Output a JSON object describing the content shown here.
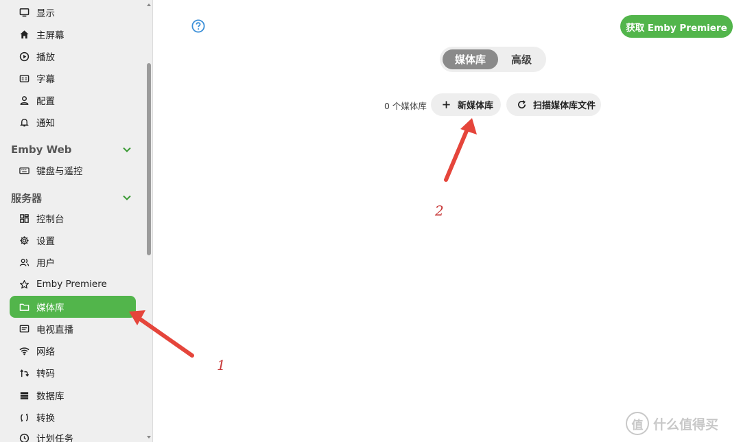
{
  "sidebar": {
    "items_top": [
      {
        "label": "显示",
        "icon": "monitor-icon"
      },
      {
        "label": "主屏幕",
        "icon": "home-icon"
      },
      {
        "label": "播放",
        "icon": "play-circle-icon"
      },
      {
        "label": "字幕",
        "icon": "subtitles-icon"
      },
      {
        "label": "配置",
        "icon": "profile-icon"
      },
      {
        "label": "通知",
        "icon": "bell-icon"
      }
    ],
    "section_web": {
      "title": "Emby Web"
    },
    "items_web": [
      {
        "label": "键盘与遥控",
        "icon": "keyboard-icon"
      }
    ],
    "section_server": {
      "title": "服务器"
    },
    "items_server": [
      {
        "label": "控制台",
        "icon": "dashboard-icon"
      },
      {
        "label": "设置",
        "icon": "gear-icon"
      },
      {
        "label": "用户",
        "icon": "users-icon"
      },
      {
        "label": "Emby Premiere",
        "icon": "star-icon"
      },
      {
        "label": "媒体库",
        "icon": "folder-icon",
        "active": true
      },
      {
        "label": "电视直播",
        "icon": "live-tv-icon"
      },
      {
        "label": "网络",
        "icon": "wifi-icon"
      },
      {
        "label": "转码",
        "icon": "transcode-icon"
      },
      {
        "label": "数据库",
        "icon": "database-icon"
      },
      {
        "label": "转换",
        "icon": "convert-icon"
      },
      {
        "label": "计划任务",
        "icon": "clock-icon"
      }
    ]
  },
  "header": {
    "premiere_button": "获取 Emby Premiere"
  },
  "tabs": [
    {
      "label": "媒体库",
      "active": true
    },
    {
      "label": "高级",
      "active": false
    }
  ],
  "library": {
    "count_text": "0 个媒体库",
    "new_button": "新媒体库",
    "scan_button": "扫描媒体库文件"
  },
  "annotations": [
    "1",
    "2"
  ],
  "watermark": {
    "text": "什么值得买",
    "logo": "值"
  },
  "colors": {
    "accent": "#52b54b",
    "arrow": "#e5453b",
    "tab_active": "#8a8a8a"
  }
}
